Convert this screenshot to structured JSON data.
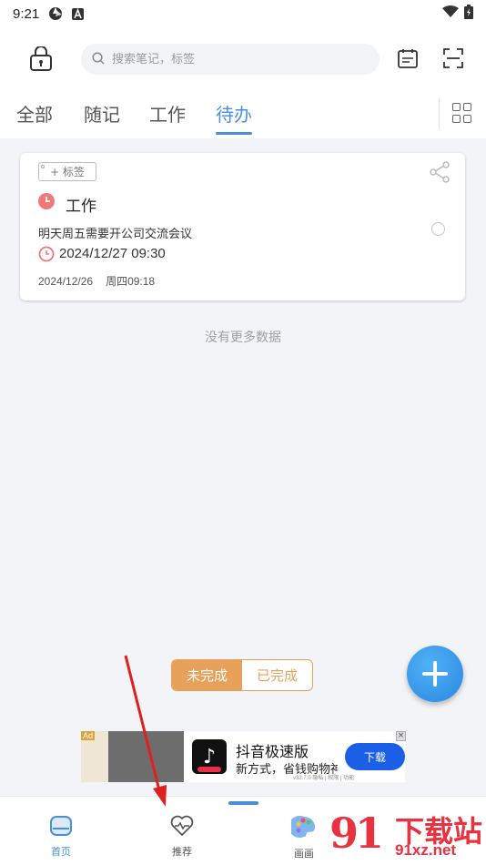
{
  "status_bar": {
    "time": "9:21",
    "icons": [
      "aperture-icon",
      "text-a-icon",
      "wifi-icon",
      "battery-charging-icon"
    ]
  },
  "search": {
    "placeholder": "搜索笔记，标签"
  },
  "tabs": [
    {
      "label": "全部",
      "active": false
    },
    {
      "label": "随记",
      "active": false
    },
    {
      "label": "工作",
      "active": false
    },
    {
      "label": "待办",
      "active": true
    }
  ],
  "note": {
    "tag_button": "+ 标签",
    "category": "工作",
    "content": "明天周五需要开公司交流会议",
    "remind_time": "2024/12/27 09:30",
    "created_date": "2024/12/26",
    "created_day": "周四09:18",
    "completed": false
  },
  "list": {
    "no_more": "没有更多数据"
  },
  "filter": {
    "incomplete": "未完成",
    "complete": "已完成",
    "selected": "未完成"
  },
  "ad": {
    "badge": "Ad",
    "app_title": "抖音极速版",
    "description": "新方式，省钱购物神",
    "download": "下载",
    "meta": "v32.7.0  隐私 | 权限 | 功能",
    "close": "×"
  },
  "bottom_nav": [
    {
      "label": "首页",
      "icon": "home-icon",
      "active": true
    },
    {
      "label": "推荐",
      "icon": "heart-pulse-icon",
      "active": false
    },
    {
      "label": "画画",
      "icon": "palette-icon",
      "active": false
    }
  ],
  "watermark": {
    "logo": "91",
    "brand": "下载站",
    "url": "91xz.net"
  },
  "colors": {
    "accent": "#4a90d9",
    "filter_orange": "#e8a15a",
    "category_red": "#f07a7a",
    "fab_blue": "#2b86e4",
    "annotation_red": "#e02020"
  }
}
